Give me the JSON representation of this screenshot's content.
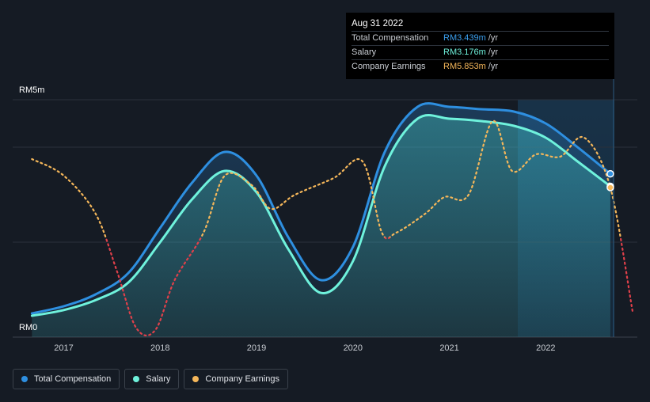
{
  "tooltip": {
    "date": "Aug 31 2022",
    "rows": [
      {
        "label": "Total Compensation",
        "value": "RM3.439m",
        "unit": "/yr",
        "color": "#3ba0f0"
      },
      {
        "label": "Salary",
        "value": "RM3.176m",
        "unit": "/yr",
        "color": "#6ff2dc"
      },
      {
        "label": "Company Earnings",
        "value": "RM5.853m",
        "unit": "/yr",
        "color": "#f5b75a"
      }
    ]
  },
  "axis": {
    "y_top_label": "RM5m",
    "y_bottom_label": "RM0"
  },
  "legend": [
    {
      "label": "Total Compensation",
      "color": "#2e8fe0"
    },
    {
      "label": "Salary",
      "color": "#6ff2dc"
    },
    {
      "label": "Company Earnings",
      "color": "#f5b75a"
    }
  ],
  "chart_data": {
    "type": "line",
    "x_tick_labels": [
      "2017",
      "2018",
      "2019",
      "2020",
      "2021",
      "2022"
    ],
    "ylim": [
      0,
      5
    ],
    "y_unit": "RM m",
    "grid": true,
    "series": [
      {
        "name": "Total Compensation",
        "color": "#2e8fe0",
        "points": [
          [
            2016.67,
            0.5
          ],
          [
            2017.0,
            0.65
          ],
          [
            2017.33,
            0.9
          ],
          [
            2017.67,
            1.35
          ],
          [
            2018.0,
            2.3
          ],
          [
            2018.33,
            3.25
          ],
          [
            2018.67,
            3.9
          ],
          [
            2019.0,
            3.4
          ],
          [
            2019.33,
            2.1
          ],
          [
            2019.67,
            1.2
          ],
          [
            2020.0,
            1.9
          ],
          [
            2020.33,
            3.9
          ],
          [
            2020.67,
            4.85
          ],
          [
            2021.0,
            4.85
          ],
          [
            2021.33,
            4.8
          ],
          [
            2021.67,
            4.75
          ],
          [
            2022.0,
            4.5
          ],
          [
            2022.33,
            4.0
          ],
          [
            2022.67,
            3.439
          ]
        ]
      },
      {
        "name": "Salary",
        "color": "#6ff2dc",
        "points": [
          [
            2016.67,
            0.45
          ],
          [
            2017.0,
            0.57
          ],
          [
            2017.33,
            0.78
          ],
          [
            2017.67,
            1.15
          ],
          [
            2018.0,
            2.0
          ],
          [
            2018.33,
            2.9
          ],
          [
            2018.67,
            3.5
          ],
          [
            2019.0,
            3.05
          ],
          [
            2019.33,
            1.85
          ],
          [
            2019.67,
            0.93
          ],
          [
            2020.0,
            1.6
          ],
          [
            2020.33,
            3.6
          ],
          [
            2020.67,
            4.6
          ],
          [
            2021.0,
            4.6
          ],
          [
            2021.33,
            4.55
          ],
          [
            2021.67,
            4.45
          ],
          [
            2022.0,
            4.2
          ],
          [
            2022.33,
            3.7
          ],
          [
            2022.67,
            3.176
          ]
        ]
      },
      {
        "name": "Company Earnings",
        "color": "#f5b75a",
        "negative_color": "#e0404a",
        "points": [
          [
            2016.67,
            3.75
          ],
          [
            2017.0,
            3.4
          ],
          [
            2017.33,
            2.6
          ],
          [
            2017.55,
            1.4
          ],
          [
            2017.75,
            0.2
          ],
          [
            2017.95,
            0.15
          ],
          [
            2018.15,
            1.2
          ],
          [
            2018.45,
            2.2
          ],
          [
            2018.67,
            3.4
          ],
          [
            2018.95,
            3.2
          ],
          [
            2019.15,
            2.7
          ],
          [
            2019.4,
            3.0
          ],
          [
            2019.8,
            3.35
          ],
          [
            2020.1,
            3.7
          ],
          [
            2020.3,
            2.2
          ],
          [
            2020.45,
            2.2
          ],
          [
            2020.75,
            2.6
          ],
          [
            2020.95,
            2.95
          ],
          [
            2021.2,
            3.0
          ],
          [
            2021.45,
            4.55
          ],
          [
            2021.65,
            3.5
          ],
          [
            2021.9,
            3.85
          ],
          [
            2022.15,
            3.8
          ],
          [
            2022.4,
            4.2
          ],
          [
            2022.67,
            3.15
          ],
          [
            2022.9,
            0.55
          ]
        ]
      }
    ],
    "highlight": {
      "date": "Aug 31 2022",
      "x": 2022.67
    }
  }
}
